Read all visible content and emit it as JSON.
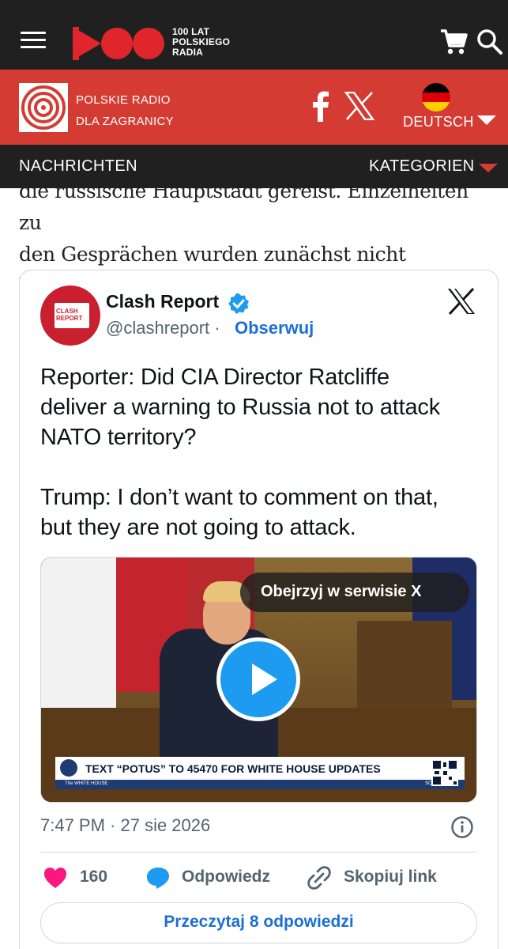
{
  "header": {
    "station_text": [
      "100 LAT",
      "POLSKIEGO",
      "RADIA"
    ],
    "icons": [
      "menu-icon",
      "polskie-radio-logo",
      "cart-icon",
      "search-icon"
    ]
  },
  "brand_bar": {
    "name_line1": "POLSKIE RADIO",
    "name_line2": "DLA ZAGRANICY",
    "language": "DEUTSCH",
    "icons": [
      "facebook-icon",
      "x-icon",
      "german-flag-icon",
      "chevron-down-icon"
    ],
    "colors": {
      "red": "#d43c33",
      "dark": "#202020"
    }
  },
  "nav": {
    "news_label": "NACHRICHTEN",
    "categories_label": "KATEGORIEN"
  },
  "article": {
    "line1": "die russische Hauptstadt gereist. Einzelheiten zu",
    "line2": "den Gesprächen wurden zunächst nicht bekannt."
  },
  "tweet": {
    "author": "Clash Report",
    "handle": "@clashreport",
    "separator": "·",
    "follow_label": "Obserwuj",
    "avatar_text": "CLASH REPORT",
    "text": "Reporter: Did CIA Director Ratcliffe\ndeliver a warning to Russia not to attack\nNATO territory?\n\nTrump: I don’t want to comment on that,\nbut they are not going to attack.",
    "video": {
      "watch_label": "Obejrzyj w serwisie X",
      "ticker": "TEXT “POTUS” TO 45470 FOR WHITE HOUSE UPDATES",
      "ticker_sub": "The WHITE HOUSE",
      "ticker_scan": "SCAN HERE"
    },
    "timestamp": "7:47 PM · 27 sie 2026",
    "likes": "160",
    "reply_label": "Odpowiedz",
    "copy_link_label": "Skopiuj link",
    "read_replies_label": "Przeczytaj 8 odpowiedzi",
    "colors": {
      "accent": "#1d9bf0",
      "link": "#1d6fd6",
      "heart": "#f91880",
      "muted": "#536471"
    }
  }
}
